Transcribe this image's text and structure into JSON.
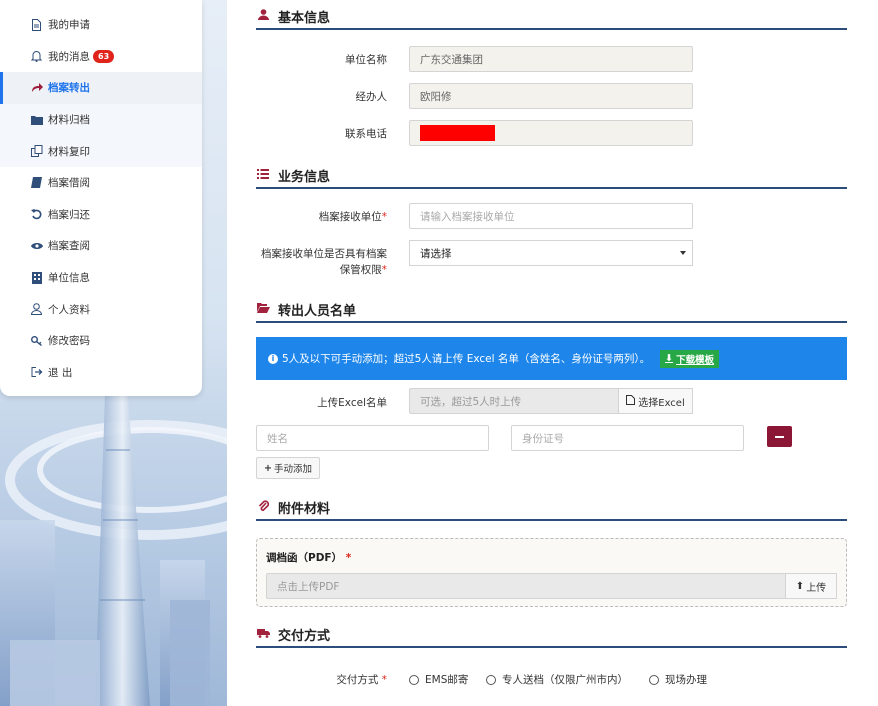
{
  "sidebar": {
    "items": [
      {
        "label": "我的申请",
        "icon": "document-icon"
      },
      {
        "label": "我的消息",
        "icon": "bell-icon",
        "badge": "63"
      },
      {
        "label": "档案转出",
        "icon": "share-arrow-icon",
        "active": true
      },
      {
        "label": "材料归档",
        "icon": "folder-icon"
      },
      {
        "label": "材料复印",
        "icon": "copy-icon"
      },
      {
        "label": "档案借阅",
        "icon": "book-icon"
      },
      {
        "label": "档案归还",
        "icon": "undo-icon"
      },
      {
        "label": "档案查阅",
        "icon": "eye-icon"
      },
      {
        "label": "单位信息",
        "icon": "building-icon"
      },
      {
        "label": "个人资料",
        "icon": "user-icon"
      },
      {
        "label": "修改密码",
        "icon": "key-icon"
      },
      {
        "label": "退 出",
        "icon": "logout-icon"
      }
    ]
  },
  "basic": {
    "title": "基本信息",
    "unit_label": "单位名称",
    "unit_value": "广东交通集团",
    "handler_label": "经办人",
    "handler_value": "欧阳修",
    "phone_label": "联系电话"
  },
  "business": {
    "title": "业务信息",
    "receiver_label": "档案接收单位",
    "receiver_placeholder": "请输入档案接收单位",
    "authority_label_1": "档案接收单位是否具有档案",
    "authority_label_2": "保管权限",
    "authority_select": "请选择"
  },
  "transfer": {
    "title": "转出人员名单",
    "notice": "5人及以下可手动添加；超过5人请上传 Excel 名单（含姓名、身份证号两列）。",
    "download_label": "下载模板",
    "excel_label": "上传Excel名单",
    "excel_placeholder": "可选，超过5人时上传",
    "excel_button": "选择Excel",
    "name_placeholder": "姓名",
    "id_placeholder": "身份证号",
    "add_button": "手动添加"
  },
  "attachments": {
    "title": "附件材料",
    "letter_label": "调档函（PDF）",
    "upload_placeholder": "点击上传PDF",
    "upload_button": "上传"
  },
  "delivery": {
    "title": "交付方式",
    "label": "交付方式",
    "options": [
      "EMS邮寄",
      "专人送档（仅限广州市内）",
      "现场办理"
    ]
  },
  "colors": {
    "accent": "#1e74ea",
    "section_icon": "#a0223c",
    "info_banner": "#1e86ea",
    "download_button": "#27a745",
    "redaction": "#ff0000"
  }
}
